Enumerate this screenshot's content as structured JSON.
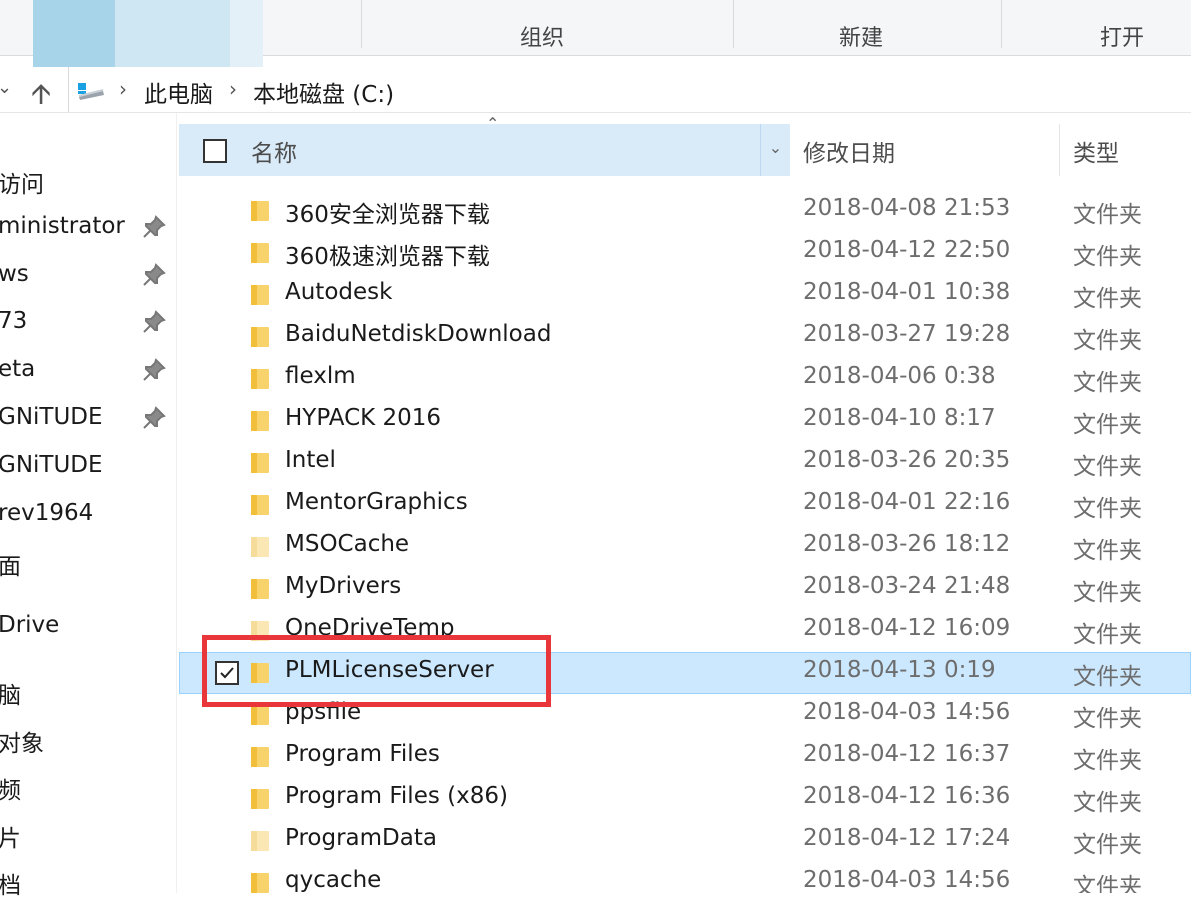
{
  "ribbon": {
    "groups": [
      "组织",
      "新建",
      "打开"
    ],
    "colors": {
      "selected_strong": "#a8d4ea",
      "selected_light": "#cfe6f3"
    }
  },
  "address": {
    "breadcrumbs": [
      "此电脑",
      "本地磁盘 (C:)"
    ]
  },
  "nav": {
    "items": [
      {
        "label": "访问",
        "pinned": false
      },
      {
        "label": "ministrator",
        "pinned": true
      },
      {
        "label": "ws",
        "pinned": true
      },
      {
        "label": "73",
        "pinned": true
      },
      {
        "label": "eta",
        "pinned": true
      },
      {
        "label": "GNiTUDE",
        "pinned": true
      },
      {
        "label": "GNiTUDE",
        "pinned": false
      },
      {
        "label": "rev1964",
        "pinned": false
      },
      {
        "label": "面",
        "pinned": false
      },
      {
        "label": "Drive",
        "pinned": false
      },
      {
        "label": "脑",
        "pinned": false
      },
      {
        "label": "对象",
        "pinned": false
      },
      {
        "label": "频",
        "pinned": false
      },
      {
        "label": "片",
        "pinned": false
      },
      {
        "label": "档",
        "pinned": false
      }
    ]
  },
  "columns": {
    "name": "名称",
    "date": "修改日期",
    "type": "类型"
  },
  "files": [
    {
      "name": "360安全浏览器下载",
      "date": "2018-04-08 21:53",
      "type": "文件夹",
      "faded": false,
      "selected": false
    },
    {
      "name": "360极速浏览器下载",
      "date": "2018-04-12 22:50",
      "type": "文件夹",
      "faded": false,
      "selected": false
    },
    {
      "name": "Autodesk",
      "date": "2018-04-01 10:38",
      "type": "文件夹",
      "faded": false,
      "selected": false
    },
    {
      "name": "BaiduNetdiskDownload",
      "date": "2018-03-27 19:28",
      "type": "文件夹",
      "faded": false,
      "selected": false
    },
    {
      "name": "flexlm",
      "date": "2018-04-06 0:38",
      "type": "文件夹",
      "faded": false,
      "selected": false
    },
    {
      "name": "HYPACK 2016",
      "date": "2018-04-10 8:17",
      "type": "文件夹",
      "faded": false,
      "selected": false
    },
    {
      "name": "Intel",
      "date": "2018-03-26 20:35",
      "type": "文件夹",
      "faded": false,
      "selected": false
    },
    {
      "name": "MentorGraphics",
      "date": "2018-04-01 22:16",
      "type": "文件夹",
      "faded": false,
      "selected": false
    },
    {
      "name": "MSOCache",
      "date": "2018-03-26 18:12",
      "type": "文件夹",
      "faded": true,
      "selected": false
    },
    {
      "name": "MyDrivers",
      "date": "2018-03-24 21:48",
      "type": "文件夹",
      "faded": false,
      "selected": false
    },
    {
      "name": "OneDriveTemp",
      "date": "2018-04-12 16:09",
      "type": "文件夹",
      "faded": true,
      "selected": false
    },
    {
      "name": "PLMLicenseServer",
      "date": "2018-04-13 0:19",
      "type": "文件夹",
      "faded": false,
      "selected": true
    },
    {
      "name": "ppsfile",
      "date": "2018-04-03 14:56",
      "type": "文件夹",
      "faded": false,
      "selected": false
    },
    {
      "name": "Program Files",
      "date": "2018-04-12 16:37",
      "type": "文件夹",
      "faded": false,
      "selected": false
    },
    {
      "name": "Program Files (x86)",
      "date": "2018-04-12 16:36",
      "type": "文件夹",
      "faded": false,
      "selected": false
    },
    {
      "name": "ProgramData",
      "date": "2018-04-12 17:24",
      "type": "文件夹",
      "faded": true,
      "selected": false
    },
    {
      "name": "qycache",
      "date": "2018-04-03 14:56",
      "type": "文件夹",
      "faded": false,
      "selected": false
    }
  ],
  "colors": {
    "selection_bg": "#cce8ff",
    "header_bg": "#d9ebf9",
    "highlight": "#e8363b",
    "folder": "#f8d26a",
    "folder_faded": "#fbe7b4"
  }
}
